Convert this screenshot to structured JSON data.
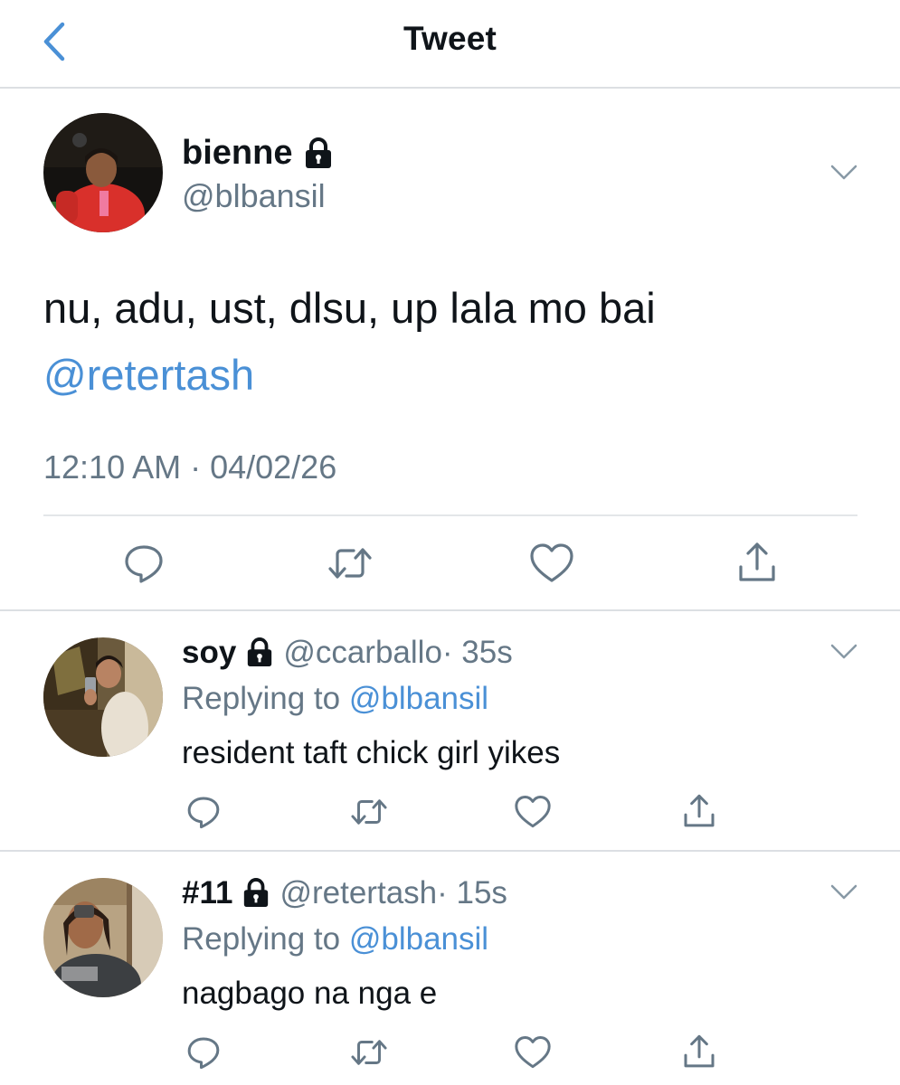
{
  "header": {
    "back_icon": "chevron-left-icon",
    "title": "Tweet"
  },
  "main_tweet": {
    "display_name": "bienne",
    "handle": "@blbansil",
    "text": "nu, adu, ust, dlsu, up lala mo bai",
    "mention": "@retertash",
    "timestamp": "12:10 AM · 04/02/26",
    "protected_icon": "lock-icon",
    "menu_icon": "chevron-down-icon",
    "actions": [
      "reply-icon",
      "retweet-icon",
      "like-icon",
      "share-icon"
    ]
  },
  "replies": [
    {
      "display_name": "soy",
      "handle": "@ccarballo",
      "time": "· 35s",
      "replying_label": "Replying to ",
      "replying_handle": "@blbansil",
      "text": "resident taft chick girl yikes"
    },
    {
      "display_name": "#11",
      "handle": "@retertash",
      "time": "· 15s",
      "replying_label": "Replying to ",
      "replying_handle": "@blbansil",
      "text": "nagbago na nga e"
    }
  ],
  "colors": {
    "accent": "#4a90d6",
    "muted": "#657786",
    "divider": "#dcdfe3",
    "icon": "#657786"
  }
}
